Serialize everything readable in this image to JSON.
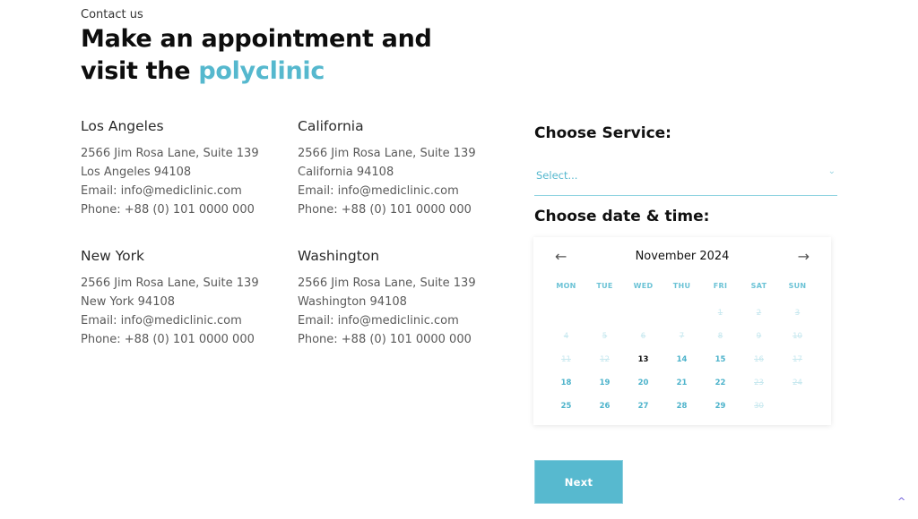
{
  "header": {
    "eyebrow": "Contact us",
    "title_line1": "Make an appointment and",
    "title_line2_prefix": "visit the ",
    "title_line2_accent": "polyclinic"
  },
  "offices": [
    {
      "city": "Los Angeles",
      "address": "2566 Jim Rosa Lane, Suite 139",
      "city_zip": "Los Angeles 94108",
      "email": "Email: info@mediclinic.com",
      "phone": "Phone: +88 (0) 101 0000 000"
    },
    {
      "city": "California",
      "address": "2566 Jim Rosa Lane, Suite 139",
      "city_zip": "California 94108",
      "email": "Email: info@mediclinic.com",
      "phone": "Phone: +88 (0) 101 0000 000"
    },
    {
      "city": "New York",
      "address": "2566 Jim Rosa Lane, Suite 139",
      "city_zip": "New York 94108",
      "email": "Email: info@mediclinic.com",
      "phone": "Phone: +88 (0) 101 0000 000"
    },
    {
      "city": "Washington",
      "address": "2566 Jim Rosa Lane, Suite 139",
      "city_zip": "Washington 94108",
      "email": "Email: info@mediclinic.com",
      "phone": "Phone: +88 (0) 101 0000 000"
    }
  ],
  "booking": {
    "service_label": "Choose Service:",
    "service_placeholder": "Select...",
    "service_chevron": "⌄",
    "datetime_label": "Choose date & time:",
    "next_label": "Next"
  },
  "calendar": {
    "month_label": "November 2024",
    "prev_icon": "←",
    "next_icon": "→",
    "weekdays": [
      "MON",
      "TUE",
      "WED",
      "THU",
      "FRI",
      "SAT",
      "SUN"
    ],
    "leading_blanks": 4,
    "days": [
      {
        "d": "1",
        "state": "disabled"
      },
      {
        "d": "2",
        "state": "disabled"
      },
      {
        "d": "3",
        "state": "disabled"
      },
      {
        "d": "4",
        "state": "disabled"
      },
      {
        "d": "5",
        "state": "disabled"
      },
      {
        "d": "6",
        "state": "disabled"
      },
      {
        "d": "7",
        "state": "disabled"
      },
      {
        "d": "8",
        "state": "disabled"
      },
      {
        "d": "9",
        "state": "disabled"
      },
      {
        "d": "10",
        "state": "disabled"
      },
      {
        "d": "11",
        "state": "disabled"
      },
      {
        "d": "12",
        "state": "disabled"
      },
      {
        "d": "13",
        "state": "today"
      },
      {
        "d": "14",
        "state": "available"
      },
      {
        "d": "15",
        "state": "available"
      },
      {
        "d": "16",
        "state": "disabled"
      },
      {
        "d": "17",
        "state": "disabled"
      },
      {
        "d": "18",
        "state": "available"
      },
      {
        "d": "19",
        "state": "available"
      },
      {
        "d": "20",
        "state": "available"
      },
      {
        "d": "21",
        "state": "available"
      },
      {
        "d": "22",
        "state": "available"
      },
      {
        "d": "23",
        "state": "disabled"
      },
      {
        "d": "24",
        "state": "disabled"
      },
      {
        "d": "25",
        "state": "available"
      },
      {
        "d": "26",
        "state": "available"
      },
      {
        "d": "27",
        "state": "available"
      },
      {
        "d": "28",
        "state": "available"
      },
      {
        "d": "29",
        "state": "available"
      },
      {
        "d": "30",
        "state": "disabled"
      }
    ]
  },
  "scroll_top_icon": "^",
  "colors": {
    "accent": "#55b8ce",
    "button": "#57b9cf",
    "disabled_day": "#c7e8ef",
    "scroll_top": "#6a56d8"
  }
}
